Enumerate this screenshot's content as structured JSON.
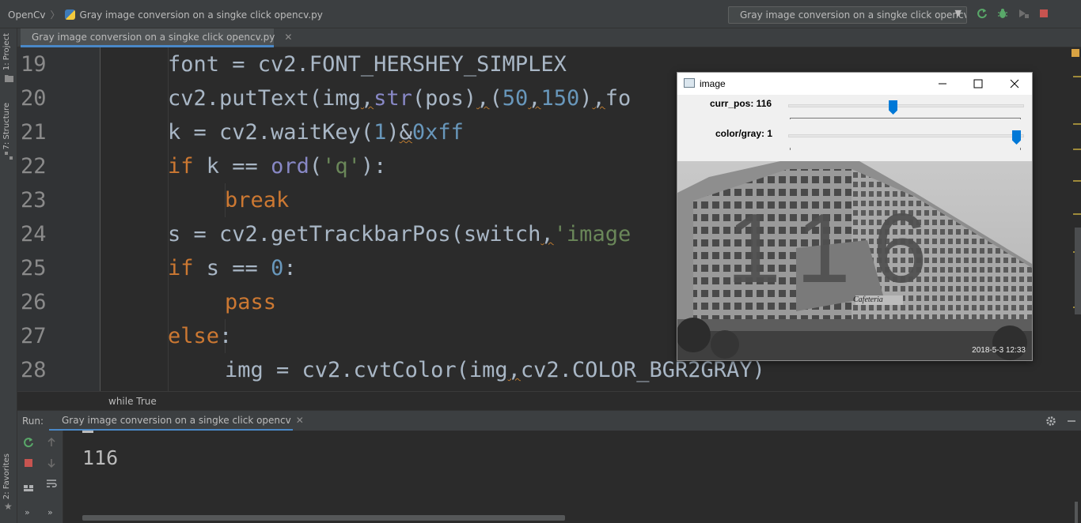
{
  "navbar": {
    "project": "OpenCv",
    "file": "Gray image conversion on a singke click opencv.py",
    "run_config": "Gray image conversion on a singke click opencv",
    "icons": [
      "rerun-icon",
      "debug-icon",
      "coverage-icon",
      "stop-icon"
    ]
  },
  "left_strip": {
    "project_tab": "1: Project",
    "structure_tab": "7: Structure",
    "favorites_tab": "2: Favorites"
  },
  "editor": {
    "tab_label": "Gray image conversion on a singke click opencv.py",
    "line_numbers": [
      "19",
      "20",
      "21",
      "22",
      "23",
      "24",
      "25",
      "26",
      "27",
      "28"
    ],
    "lines": [
      "font = cv2.FONT_HERSHEY_SIMPLEX",
      "cv2.putText(img,str(pos),(50,150),fo",
      "k = cv2.waitKey(1)&0xff",
      "if k == ord('q'):",
      "break",
      "s = cv2.getTrackbarPos(switch,'image",
      "if s == 0:",
      "pass",
      "else:",
      "img = cv2.cvtColor(img,cv2.COLOR_BGR2GRAY)"
    ],
    "breadcrumb": "while True"
  },
  "cv_window": {
    "title": "image",
    "trackbar1_label": "curr_pos: 116",
    "trackbar1_value": 116,
    "trackbar2_label": "color/gray: 1",
    "trackbar2_value": 1,
    "overlay_text": "116",
    "sign_text": "Cafeteria",
    "timestamp": "2018-5-3 12:33"
  },
  "run_panel": {
    "label": "Run:",
    "tab_label": "Gray image conversion on a singke click opencv",
    "output": "116"
  },
  "colors": {
    "keyword": "#cc7832",
    "number": "#6897bb",
    "string": "#6a8759",
    "builtin": "#8888c6",
    "text": "#a9b7c6",
    "accent": "#4a88c7",
    "thumb": "#0078d7"
  }
}
